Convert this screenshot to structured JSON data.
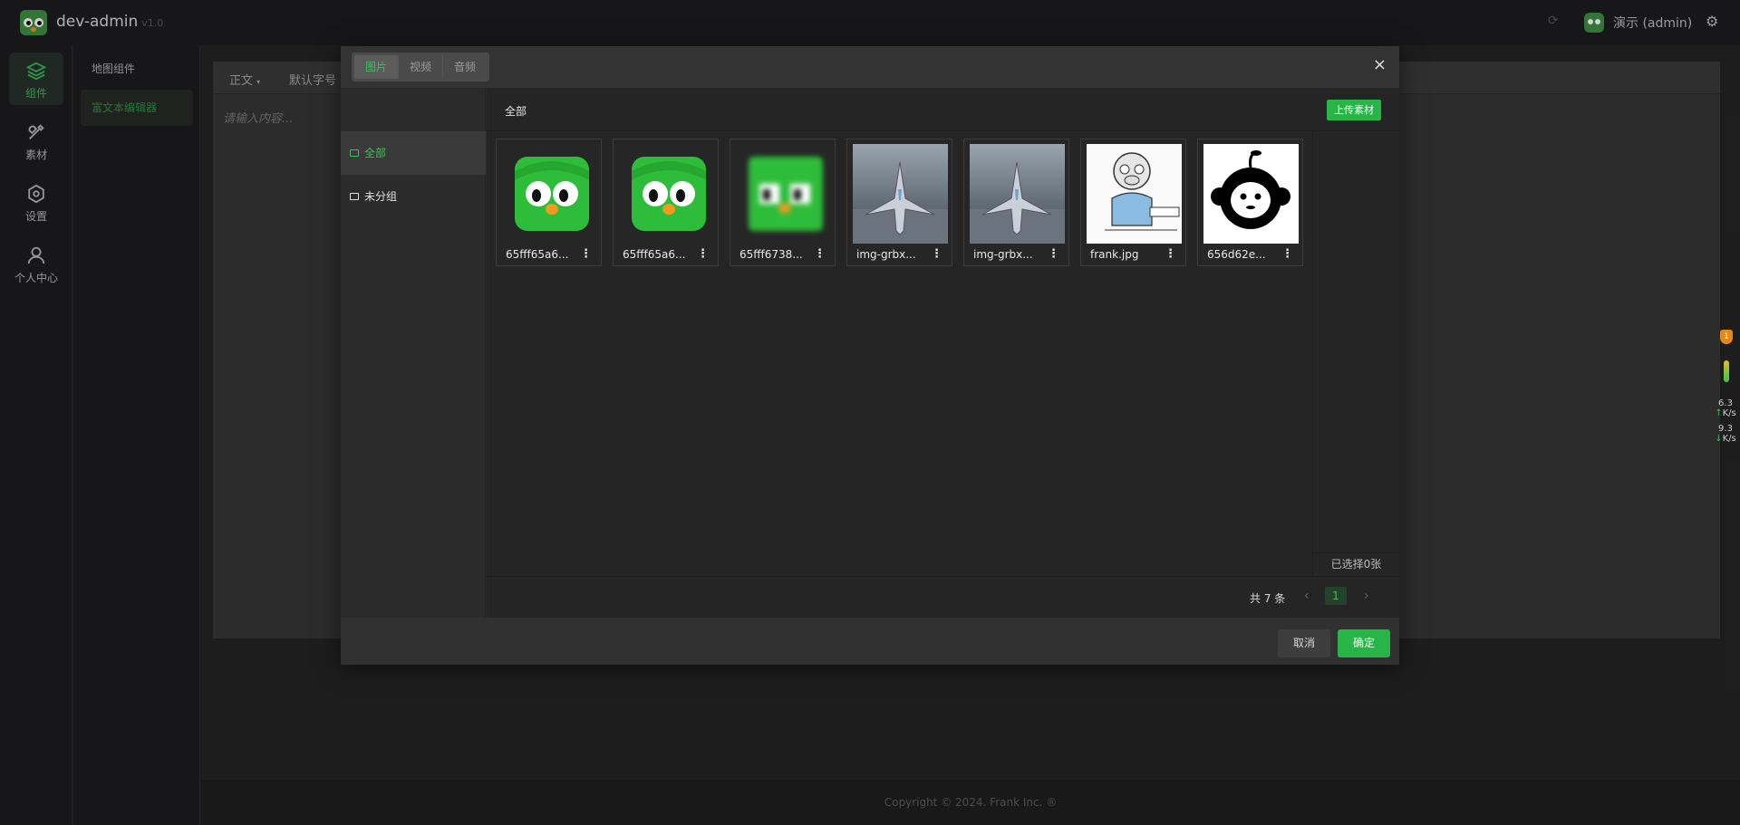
{
  "app": {
    "title": "dev-admin",
    "version": "v1.0"
  },
  "topbar": {
    "user": "演示 (admin)"
  },
  "rail": [
    {
      "label": "组件",
      "icon": "layers-icon",
      "active": true
    },
    {
      "label": "素材",
      "icon": "tools-icon"
    },
    {
      "label": "设置",
      "icon": "settings-icon"
    },
    {
      "label": "个人中心",
      "icon": "user-icon"
    }
  ],
  "submenu": [
    {
      "label": "地图组件"
    },
    {
      "label": "富文本编辑器",
      "active": true
    }
  ],
  "editor": {
    "style_select": "正文",
    "size_select": "默认字号",
    "placeholder": "请输入内容..."
  },
  "footer": {
    "copyright": "Copyright © 2024. Frank Inc. ®"
  },
  "modal": {
    "tabs": [
      {
        "label": "图片",
        "active": true
      },
      {
        "label": "视频"
      },
      {
        "label": "音频"
      }
    ],
    "groups": [
      {
        "label": "全部",
        "active": true
      },
      {
        "label": "未分组"
      }
    ],
    "content_title": "全部",
    "upload_label": "上传素材",
    "files": [
      {
        "name": "65fff65a6...",
        "thumb": "owl"
      },
      {
        "name": "65fff65a6...",
        "thumb": "owl"
      },
      {
        "name": "65fff6738...",
        "thumb": "owl-blur"
      },
      {
        "name": "img-grbx...",
        "thumb": "jet"
      },
      {
        "name": "img-grbx...",
        "thumb": "jet"
      },
      {
        "name": "frank.jpg",
        "thumb": "monkey-sketch"
      },
      {
        "name": "656d62e...",
        "thumb": "monkey-icon"
      }
    ],
    "selected": "已选择0张",
    "pager": {
      "total": "共 7 条",
      "page": "1"
    },
    "cancel": "取消",
    "confirm": "确定"
  },
  "float_widget": {
    "badge": "1",
    "upload": "6.3",
    "download": "9.3",
    "unit": "K/s"
  },
  "colors": {
    "accent": "#28b446",
    "background": "#242424",
    "modal": "#2b2b2b"
  }
}
